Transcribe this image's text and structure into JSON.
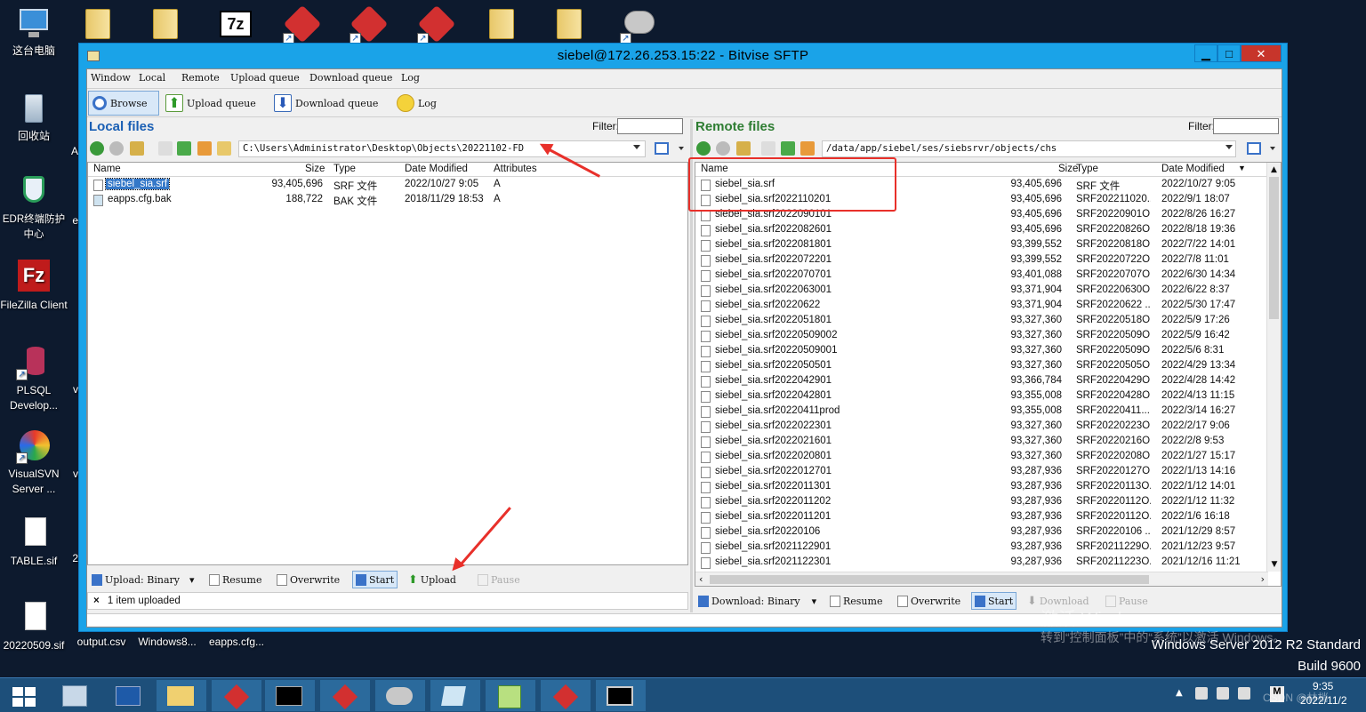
{
  "desktop": {
    "left_icons": [
      {
        "label": "这台电脑",
        "icon": "computer-icon"
      },
      {
        "label": "回收站",
        "icon": "recycle-bin-icon"
      },
      {
        "label": "EDR终端防护中心",
        "icon": "shield-icon"
      },
      {
        "label": "FileZilla Client",
        "icon": "filezilla-icon"
      },
      {
        "label": "PLSQL Develop...",
        "icon": "database-icon"
      },
      {
        "label": "VisualSVN Server ...",
        "icon": "svn-icon"
      },
      {
        "label": "TABLE.sif",
        "icon": "document-icon"
      },
      {
        "label": "20220509.sif",
        "icon": "document-icon"
      }
    ],
    "bottom_labels": [
      "output.csv",
      "Windows8...",
      "eapps.cfg..."
    ],
    "top_icon_7z": "7z",
    "edge_fragments": [
      "A",
      "e",
      "v",
      "v",
      "2"
    ]
  },
  "window": {
    "title": "siebel@172.26.253.15:22 - Bitvise SFTP",
    "controls": {
      "minimize": "▁",
      "maximize": "□",
      "close": "✕"
    },
    "menu": [
      "Window",
      "Local",
      "Remote",
      "Upload queue",
      "Download queue",
      "Log"
    ],
    "toolbar": [
      {
        "label": "Browse",
        "icon": "magnifier-icon"
      },
      {
        "label": "Upload queue",
        "icon": "upload-arrow-icon"
      },
      {
        "label": "Download queue",
        "icon": "download-arrow-icon"
      },
      {
        "label": "Log",
        "icon": "speech-bubble-icon"
      }
    ]
  },
  "local": {
    "title": "Local files",
    "filter_label": "Filter:",
    "filter_value": "",
    "path": "C:\\Users\\Administrator\\Desktop\\Objects\\20221102-FD",
    "columns": [
      "Name",
      "Size",
      "Type",
      "Date Modified",
      "Attributes"
    ],
    "files": [
      {
        "name": "siebel_sia.srf",
        "size": "93,405,696",
        "type": "SRF 文件",
        "date": "2022/10/27 9:05",
        "attr": "A"
      },
      {
        "name": "eapps.cfg.bak",
        "size": "188,722",
        "type": "BAK 文件",
        "date": "2018/11/29 18:53",
        "attr": "A"
      }
    ],
    "bottom": {
      "mode": "Upload: Binary",
      "resume": "Resume",
      "overwrite": "Overwrite",
      "start": "Start",
      "upload": "Upload",
      "pause": "Pause"
    },
    "status": "1 item uploaded",
    "status_icon": "×"
  },
  "remote": {
    "title": "Remote files",
    "filter_label": "Filter:",
    "filter_value": "",
    "path": "/data/app/siebel/ses/siebsrvr/objects/chs",
    "columns": [
      "Name",
      "Size",
      "Type",
      "Date Modified"
    ],
    "files": [
      {
        "name": "siebel_sia.srf",
        "size": "93,405,696",
        "type": "SRF 文件",
        "date": "2022/10/27 9:05"
      },
      {
        "name": "siebel_sia.srf2022110201",
        "size": "93,405,696",
        "type": "SRF202211020...",
        "date": "2022/9/1 18:07"
      },
      {
        "name": "siebel_sia.srf2022090101",
        "size": "93,405,696",
        "type": "SRF20220901O...",
        "date": "2022/8/26 16:27"
      },
      {
        "name": "siebel_sia.srf2022082601",
        "size": "93,405,696",
        "type": "SRF20220826O...",
        "date": "2022/8/18 19:36"
      },
      {
        "name": "siebel_sia.srf2022081801",
        "size": "93,399,552",
        "type": "SRF20220818O...",
        "date": "2022/7/22 14:01"
      },
      {
        "name": "siebel_sia.srf2022072201",
        "size": "93,399,552",
        "type": "SRF20220722O...",
        "date": "2022/7/8 11:01"
      },
      {
        "name": "siebel_sia.srf2022070701",
        "size": "93,401,088",
        "type": "SRF20220707O...",
        "date": "2022/6/30 14:34"
      },
      {
        "name": "siebel_sia.srf2022063001",
        "size": "93,371,904",
        "type": "SRF20220630O...",
        "date": "2022/6/22 8:37"
      },
      {
        "name": "siebel_sia.srf20220622",
        "size": "93,371,904",
        "type": "SRF20220622 ...",
        "date": "2022/5/30 17:47"
      },
      {
        "name": "siebel_sia.srf2022051801",
        "size": "93,327,360",
        "type": "SRF20220518O...",
        "date": "2022/5/9 17:26"
      },
      {
        "name": "siebel_sia.srf20220509002",
        "size": "93,327,360",
        "type": "SRF20220509O...",
        "date": "2022/5/9 16:42"
      },
      {
        "name": "siebel_sia.srf20220509001",
        "size": "93,327,360",
        "type": "SRF20220509O...",
        "date": "2022/5/6 8:31"
      },
      {
        "name": "siebel_sia.srf2022050501",
        "size": "93,327,360",
        "type": "SRF20220505O...",
        "date": "2022/4/29 13:34"
      },
      {
        "name": "siebel_sia.srf2022042901",
        "size": "93,366,784",
        "type": "SRF20220429O...",
        "date": "2022/4/28 14:42"
      },
      {
        "name": "siebel_sia.srf2022042801",
        "size": "93,355,008",
        "type": "SRF20220428O...",
        "date": "2022/4/13 11:15"
      },
      {
        "name": "siebel_sia.srf20220411prod",
        "size": "93,355,008",
        "type": "SRF20220411...",
        "date": "2022/3/14 16:27"
      },
      {
        "name": "siebel_sia.srf2022022301",
        "size": "93,327,360",
        "type": "SRF20220223O...",
        "date": "2022/2/17 9:06"
      },
      {
        "name": "siebel_sia.srf2022021601",
        "size": "93,327,360",
        "type": "SRF20220216O...",
        "date": "2022/2/8 9:53"
      },
      {
        "name": "siebel_sia.srf2022020801",
        "size": "93,327,360",
        "type": "SRF20220208O...",
        "date": "2022/1/27 15:17"
      },
      {
        "name": "siebel_sia.srf2022012701",
        "size": "93,287,936",
        "type": "SRF20220127O...",
        "date": "2022/1/13 14:16"
      },
      {
        "name": "siebel_sia.srf2022011301",
        "size": "93,287,936",
        "type": "SRF20220113O...",
        "date": "2022/1/12 14:01"
      },
      {
        "name": "siebel_sia.srf2022011202",
        "size": "93,287,936",
        "type": "SRF20220112O...",
        "date": "2022/1/12 11:32"
      },
      {
        "name": "siebel_sia.srf2022011201",
        "size": "93,287,936",
        "type": "SRF20220112O...",
        "date": "2022/1/6 16:18"
      },
      {
        "name": "siebel_sia.srf20220106",
        "size": "93,287,936",
        "type": "SRF20220106 ...",
        "date": "2021/12/29 8:57"
      },
      {
        "name": "siebel_sia.srf2021122901",
        "size": "93,287,936",
        "type": "SRF20211229O...",
        "date": "2021/12/23 9:57"
      },
      {
        "name": "siebel_sia.srf2021122301",
        "size": "93,287,936",
        "type": "SRF20211223O...",
        "date": "2021/12/16 11:21"
      }
    ],
    "bottom": {
      "mode": "Download: Binary",
      "resume": "Resume",
      "overwrite": "Overwrite",
      "start": "Start",
      "download": "Download",
      "pause": "Pause"
    }
  },
  "overlay": {
    "activate_title": "激活 Windows",
    "activate_sub": "转到“控制面板”中的“系统”以激活 Windows。",
    "os_name": "Windows Server 2012 R2 Standard",
    "build": "Build 9600",
    "csdn": "CSDN @林梢"
  },
  "taskbar": {
    "time": "9:35",
    "date": "2022/11/2",
    "lang": "M"
  },
  "colors": {
    "title_bar": "#1aa3e8",
    "accent_red": "#e8302a",
    "pane_title": "#1a5fb4",
    "remote_title": "#2e7d32"
  }
}
